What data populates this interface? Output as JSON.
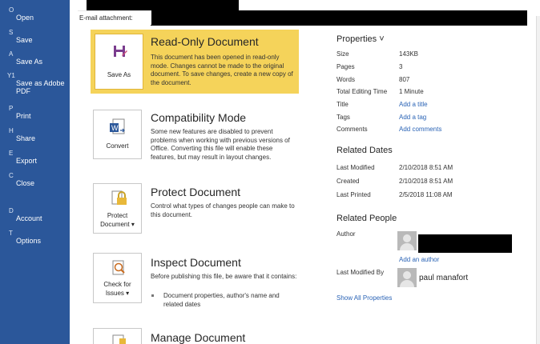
{
  "nav": {
    "items": [
      {
        "key": "O",
        "label": "Open"
      },
      {
        "key": "S",
        "label": "Save"
      },
      {
        "key": "A",
        "label": "Save As"
      },
      {
        "key": "Y1",
        "label": "Save as Adobe PDF"
      },
      {
        "key": "P",
        "label": "Print"
      },
      {
        "key": "H",
        "label": "Share"
      },
      {
        "key": "E",
        "label": "Export"
      },
      {
        "key": "C",
        "label": "Close"
      },
      {
        "key": "D",
        "label": "Account"
      },
      {
        "key": "T",
        "label": "Options"
      }
    ]
  },
  "header": {
    "attachment_label": "E-mail attachment:"
  },
  "sections": {
    "readonly": {
      "button_label": "Save As",
      "title": "Read-Only Document",
      "text": "This document has been opened in read-only mode. Changes cannot be made to the original document. To save changes, create a new copy of the document."
    },
    "compat": {
      "button_label": "Convert",
      "title": "Compatibility Mode",
      "text": "Some new features are disabled to prevent problems when working with previous versions of Office. Converting this file will enable these features, but may result in layout changes."
    },
    "protect": {
      "button_label_1": "Protect",
      "button_label_2": "Document ▾",
      "title": "Protect Document",
      "text": "Control what types of changes people can make to this document."
    },
    "inspect": {
      "button_label_1": "Check for",
      "button_label_2": "Issues ▾",
      "title": "Inspect Document",
      "text": "Before publishing this file, be aware that it contains:",
      "bullet": "Document properties, author's name and related dates"
    },
    "manage": {
      "title": "Manage Document"
    }
  },
  "properties": {
    "heading": "Properties ˅",
    "rows": [
      {
        "key": "Size",
        "value": "143KB"
      },
      {
        "key": "Pages",
        "value": "3"
      },
      {
        "key": "Words",
        "value": "807"
      },
      {
        "key": "Total Editing Time",
        "value": "1 Minute"
      },
      {
        "key": "Title",
        "value": "Add a title"
      },
      {
        "key": "Tags",
        "value": "Add a tag"
      },
      {
        "key": "Comments",
        "value": "Add comments"
      }
    ],
    "dates_heading": "Related Dates",
    "dates": [
      {
        "key": "Last Modified",
        "value": "2/10/2018 8:51 AM"
      },
      {
        "key": "Created",
        "value": "2/10/2018 8:51 AM"
      },
      {
        "key": "Last Printed",
        "value": "2/5/2018 11:08 AM"
      }
    ],
    "people_heading": "Related People",
    "author_label": "Author",
    "add_author": "Add an author",
    "last_modified_by_label": "Last Modified By",
    "last_modified_by_name": "paul manafort",
    "show_all": "Show All Properties"
  },
  "colors": {
    "nav_bg": "#2b579a",
    "highlight": "#f5d35a",
    "link": "#2b64b6"
  }
}
